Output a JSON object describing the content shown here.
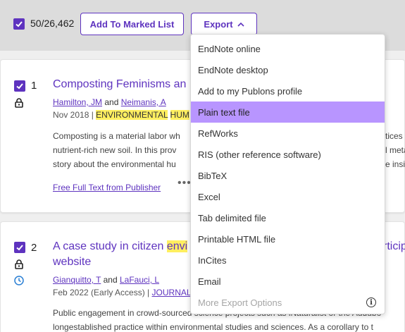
{
  "toolbar": {
    "selected_count": "50/26,462",
    "add_to_marked_list": "Add To Marked List",
    "export_label": "Export"
  },
  "records": [
    {
      "number": "1",
      "title_visible": "Composting Feminisms an",
      "authors": [
        "Hamilton, JM",
        "Neimanis, A"
      ],
      "author_separator": "and",
      "date": "Nov 2018 |",
      "tag1": "ENVIRONMENTAL",
      "tag2": "HUM",
      "abstract_lines": [
        "Composting is a material labor wh",
        "nutrient-rich new soil. In this prov",
        "story about the environmental hu"
      ],
      "abstract_right_fragments": [
        "tices c",
        "l meta",
        "e insi"
      ],
      "full_text_link": "Free Full Text from Publisher",
      "more_label": "•••"
    },
    {
      "number": "2",
      "title_line1_start": "A case study in citizen ",
      "title_line1_hl": "envi",
      "title_line1_end": "rticip",
      "title_line2": "website",
      "authors": [
        "Gianquitto, T",
        "LaFauci, L"
      ],
      "author_separator": "and",
      "date": "Feb 2022 (Early Access) |",
      "journal": "JOURNAL",
      "abstract_lines": [
        "Public engagement in crowd-sourced science projects such as iNaturalist or the Audubo",
        "longestablished practice within environmental studies and sciences. As a corollary to t"
      ]
    }
  ],
  "export_menu": {
    "items": [
      "EndNote online",
      "EndNote desktop",
      "Add to my Publons profile",
      "Plain text file",
      "RefWorks",
      "RIS (other reference software)",
      "BibTeX",
      "Excel",
      "Tab delimited file",
      "Printable HTML file",
      "InCites",
      "Email",
      "More Export Options"
    ],
    "selected_index": 3,
    "info_glyph": "i"
  },
  "colors": {
    "accent": "#5e33bf",
    "highlight": "#ffef60",
    "menu_selected": "#b895ff"
  }
}
